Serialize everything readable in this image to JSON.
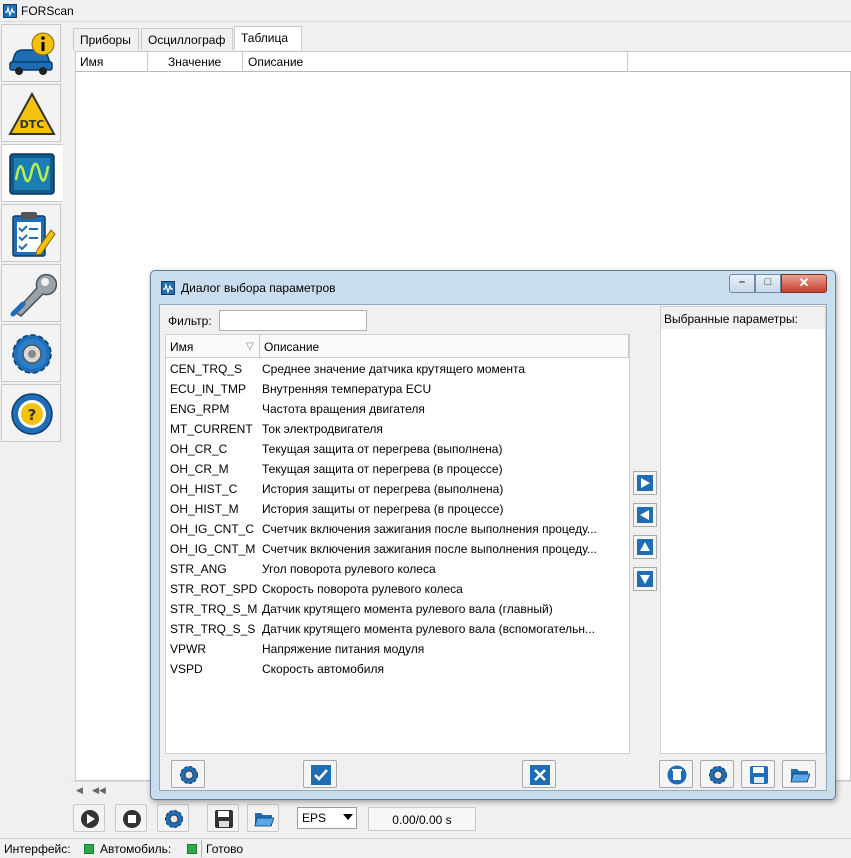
{
  "window": {
    "title": "FORScan"
  },
  "sidebar": {
    "items": [
      {
        "icon": "car-info-icon"
      },
      {
        "icon": "dtc-warning-icon"
      },
      {
        "icon": "oscilloscope-icon"
      },
      {
        "icon": "checklist-icon"
      },
      {
        "icon": "wrench-icon"
      },
      {
        "icon": "gear-settings-icon"
      },
      {
        "icon": "help-steering-icon"
      }
    ]
  },
  "tabs": [
    {
      "label": "Приборы"
    },
    {
      "label": "Осциллограф"
    },
    {
      "label": "Таблица"
    }
  ],
  "main_table": {
    "columns": [
      "Имя",
      "Значение",
      "Описание"
    ]
  },
  "bottom": {
    "format_select": "EPS",
    "time_display": "0.00/0.00 s"
  },
  "status": {
    "interface_label": "Интерфейс:",
    "car_label": "Автомобиль:",
    "state": "Готово",
    "led_color": "#2aa84a"
  },
  "dialog": {
    "title": "Диалог выбора параметров",
    "filter_label": "Фильтр:",
    "filter_value": "",
    "list_columns": [
      "Имя",
      "Описание"
    ],
    "parameters": [
      {
        "name": "CEN_TRQ_S",
        "desc": "Среднее значение датчика крутящего момента"
      },
      {
        "name": "ECU_IN_TMP",
        "desc": "Внутренняя температура ECU"
      },
      {
        "name": "ENG_RPM",
        "desc": "Частота вращения двигателя"
      },
      {
        "name": "MT_CURRENT",
        "desc": "Ток электродвигателя"
      },
      {
        "name": "OH_CR_C",
        "desc": "Текущая защита от перегрева (выполнена)"
      },
      {
        "name": "OH_CR_M",
        "desc": "Текущая защита от перегрева (в процессе)"
      },
      {
        "name": "OH_HIST_C",
        "desc": "История защиты от перегрева (выполнена)"
      },
      {
        "name": "OH_HIST_M",
        "desc": "История защиты от перегрева (в процессе)"
      },
      {
        "name": "OH_IG_CNT_C",
        "desc": "Счетчик включения зажигания после выполнения процеду..."
      },
      {
        "name": "OH_IG_CNT_M",
        "desc": "Счетчик включения зажигания после выполнения процеду..."
      },
      {
        "name": "STR_ANG",
        "desc": "Угол поворота рулевого колеса"
      },
      {
        "name": "STR_ROT_SPD",
        "desc": "Скорость поворота рулевого колеса"
      },
      {
        "name": "STR_TRQ_S_M",
        "desc": "Датчик крутящего момента рулевого вала (главный)"
      },
      {
        "name": "STR_TRQ_S_S",
        "desc": "Датчик крутящего момента рулевого вала (вспомогательн..."
      },
      {
        "name": "VPWR",
        "desc": "Напряжение питания модуля"
      },
      {
        "name": "VSPD",
        "desc": "Скорость автомобиля"
      }
    ],
    "selected_label": "Выбранные параметры:",
    "accent_color": "#1f6fb2"
  }
}
